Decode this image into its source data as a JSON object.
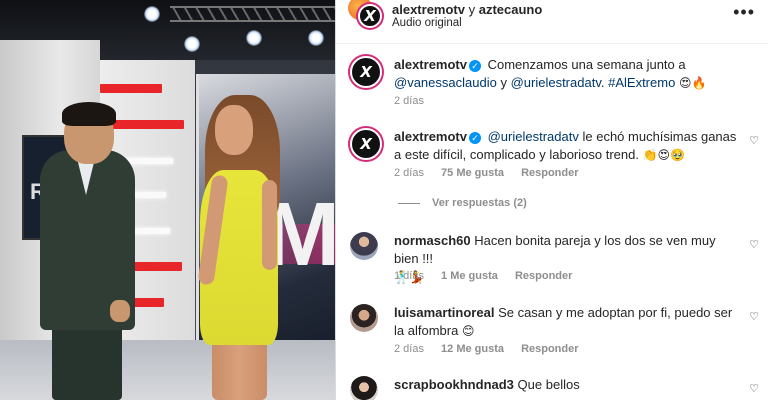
{
  "post": {
    "header": {
      "account": "alextremotv",
      "joiner": "y",
      "collaborator": "aztecauno",
      "subtitle": "Audio original",
      "more_icon": "more-horizontal-icon",
      "more_label": "•••"
    },
    "media": {
      "screen_left_text": "R",
      "screen_right_text": "M"
    }
  },
  "comments": [
    {
      "user": "alextremotv",
      "verified": true,
      "avatar_label": "X",
      "text_parts": {
        "pre": "Comenzamos una semana junto a",
        "mention1": "@vanessaclaudio",
        "mid": "y",
        "mention2": "@urielestradatv",
        "post": ".",
        "hashtag": "#AlExtremo",
        "emojis": "😍🔥"
      },
      "time": "2 días"
    },
    {
      "user": "alextremotv",
      "verified": true,
      "avatar_label": "X",
      "text_parts": {
        "mention": "@urielestradatv",
        "body": "le echó muchísimas ganas a este difícil, complicado y laborioso trend.",
        "emojis": "👏😍🥹"
      },
      "time": "2 días",
      "likes": "75 Me gusta",
      "reply_label": "Responder",
      "view_replies": "Ver respuestas (2)"
    },
    {
      "user": "normasch60",
      "text": "Hacen bonita pareja y los dos se ven muy bien !!!",
      "emojis": "🕺💃",
      "time": "1 días",
      "likes": "1 Me gusta",
      "reply_label": "Responder"
    },
    {
      "user": "luisamartinoreal",
      "text": "Se casan y me adoptan por fi, puedo ser la alfombra",
      "emojis": "😊",
      "time": "2 días",
      "likes": "12 Me gusta",
      "reply_label": "Responder"
    },
    {
      "user": "scrapbookhndnad3",
      "text": "Que bellos"
    }
  ],
  "icons": {
    "heart": "♡",
    "verified": "✓"
  }
}
